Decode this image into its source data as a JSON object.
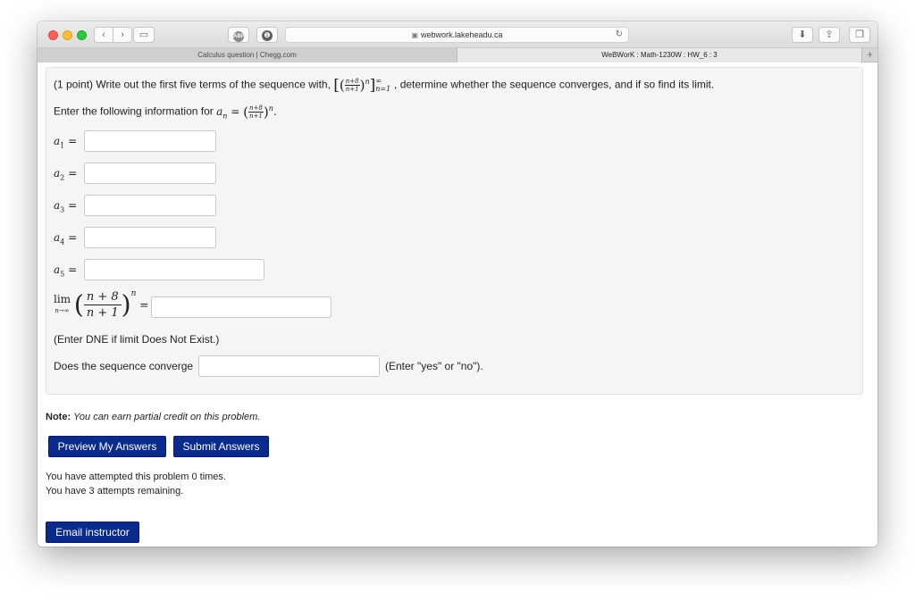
{
  "browser": {
    "address": "webwork.lakeheadu.ca",
    "abp_label": "ABP",
    "tabs": [
      {
        "label": "Calculus question | Chegg.com"
      },
      {
        "label": "WeBWorK : Math-1230W : HW_6 : 3"
      }
    ],
    "newtab": "+",
    "nav_back": "‹",
    "nav_fwd": "›",
    "reload": "↻",
    "download": "⬇",
    "share": "⇪",
    "tabs_icon": "❐",
    "sidebar": "▭",
    "lock": "🔒"
  },
  "problem": {
    "intro_prefix": "(1 point) Write out the first five terms of the sequence with,",
    "intro_suffix": ", determine whether the sequence converges, and if so find its limit.",
    "enter_info": "Enter the following information for",
    "frac_num": "n+8",
    "frac_den": "n+1",
    "exp_n": "n",
    "seq_sup": "∞",
    "seq_sub": "n=1",
    "a_label": "a",
    "a_sub_n": "n",
    "a_equals": "=",
    "rows": [
      {
        "sub": "1",
        "eq": "="
      },
      {
        "sub": "2",
        "eq": "="
      },
      {
        "sub": "3",
        "eq": "="
      },
      {
        "sub": "4",
        "eq": "="
      },
      {
        "sub": "5",
        "eq": "="
      }
    ],
    "lim_label": "lim",
    "lim_sub": "n→∞",
    "lim_num": "n + 8",
    "lim_den": "n + 1",
    "lim_exp": "n",
    "lim_eq": "=",
    "dne_hint": "(Enter DNE if limit Does Not Exist.)",
    "converge_label": "Does the sequence converge",
    "converge_hint": "(Enter \"yes\" or \"no\")."
  },
  "note_label": "Note:",
  "note_text": "You can earn partial credit on this problem.",
  "buttons": {
    "preview": "Preview My Answers",
    "submit": "Submit Answers",
    "email": "Email instructor"
  },
  "attempts": {
    "line1": "You have attempted this problem 0 times.",
    "line2": "You have 3 attempts remaining."
  }
}
